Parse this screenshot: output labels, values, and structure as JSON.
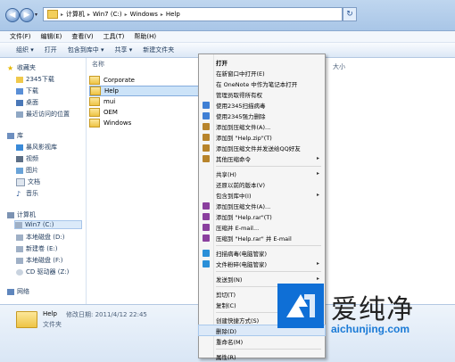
{
  "address": {
    "segments": [
      "计算机",
      "Win7 (C:)",
      "Windows",
      "Help"
    ]
  },
  "menubar": [
    "文件(F)",
    "编辑(E)",
    "查看(V)",
    "工具(T)",
    "帮助(H)"
  ],
  "toolbar": [
    "组织 ▾",
    "打开",
    "包含到库中 ▾",
    "共享 ▾",
    "新建文件夹"
  ],
  "sidebar": {
    "favorites_header": "收藏夹",
    "favorites": [
      "2345下载",
      "下载",
      "桌面",
      "最近访问的位置"
    ],
    "libraries_header": "库",
    "libraries": [
      "暴风影视库",
      "视频",
      "图片",
      "文档",
      "音乐"
    ],
    "computer_header": "计算机",
    "drives": [
      "Win7 (C:)",
      "本地磁盘 (D:)",
      "新建卷 (E:)",
      "本地磁盘 (F:)",
      "CD 驱动器 (Z:)"
    ],
    "network": "网络"
  },
  "columns": {
    "name": "名称",
    "size": "大小"
  },
  "files": [
    "Corporate",
    "Help",
    "mui",
    "OEM",
    "Windows"
  ],
  "status": {
    "name": "Help",
    "modified": "修改日期: 2011/4/12 22:45",
    "type": "文件夹"
  },
  "context_menu": [
    {
      "label": "打开",
      "bold": true
    },
    {
      "label": "在新窗口中打开(E)"
    },
    {
      "label": "在 OneNote 中作为笔记本打开"
    },
    {
      "label": "管理员取得所有权"
    },
    {
      "label": "使用2345扫描病毒",
      "icon": "shield-icon"
    },
    {
      "label": "使用2345强力删除",
      "icon": "shield-icon"
    },
    {
      "label": "添加到压缩文件(A)...",
      "icon": "archive-icon"
    },
    {
      "label": "添加到 \"Help.zip\"(T)",
      "icon": "archive-icon"
    },
    {
      "label": "添加到压缩文件并发送给QQ好友",
      "icon": "archive-icon"
    },
    {
      "label": "其他压缩命令",
      "icon": "archive-icon",
      "submenu": true
    },
    {
      "separator": true
    },
    {
      "label": "共享(H)",
      "submenu": true
    },
    {
      "label": "还原以前的版本(V)"
    },
    {
      "label": "包含到库中(I)",
      "submenu": true
    },
    {
      "label": "添加到压缩文件(A)...",
      "icon": "rar-icon"
    },
    {
      "label": "添加到 \"Help.rar\"(T)",
      "icon": "rar-icon"
    },
    {
      "label": "压缩并 E-mail...",
      "icon": "rar-icon"
    },
    {
      "label": "压缩到 \"Help.rar\" 并 E-mail",
      "icon": "rar-icon"
    },
    {
      "separator": true
    },
    {
      "label": "扫描病毒(电脑管家)",
      "icon": "guard-icon"
    },
    {
      "label": "文件粉碎(电脑管家)",
      "icon": "guard-icon",
      "submenu": true
    },
    {
      "separator": true
    },
    {
      "label": "发送到(N)",
      "submenu": true
    },
    {
      "separator": true
    },
    {
      "label": "剪切(T)"
    },
    {
      "label": "复制(C)"
    },
    {
      "separator": true
    },
    {
      "label": "创建快捷方式(S)"
    },
    {
      "label": "删除(D)",
      "highlight": true
    },
    {
      "label": "重命名(M)"
    },
    {
      "separator": true
    },
    {
      "label": "属性(R)"
    }
  ],
  "watermark": {
    "brand": "爱纯净",
    "url": "aichunjing.com"
  },
  "colors": {
    "accent": "#0f6fd6",
    "menu_highlight": "#dce9f8",
    "folder": "#eec445"
  }
}
